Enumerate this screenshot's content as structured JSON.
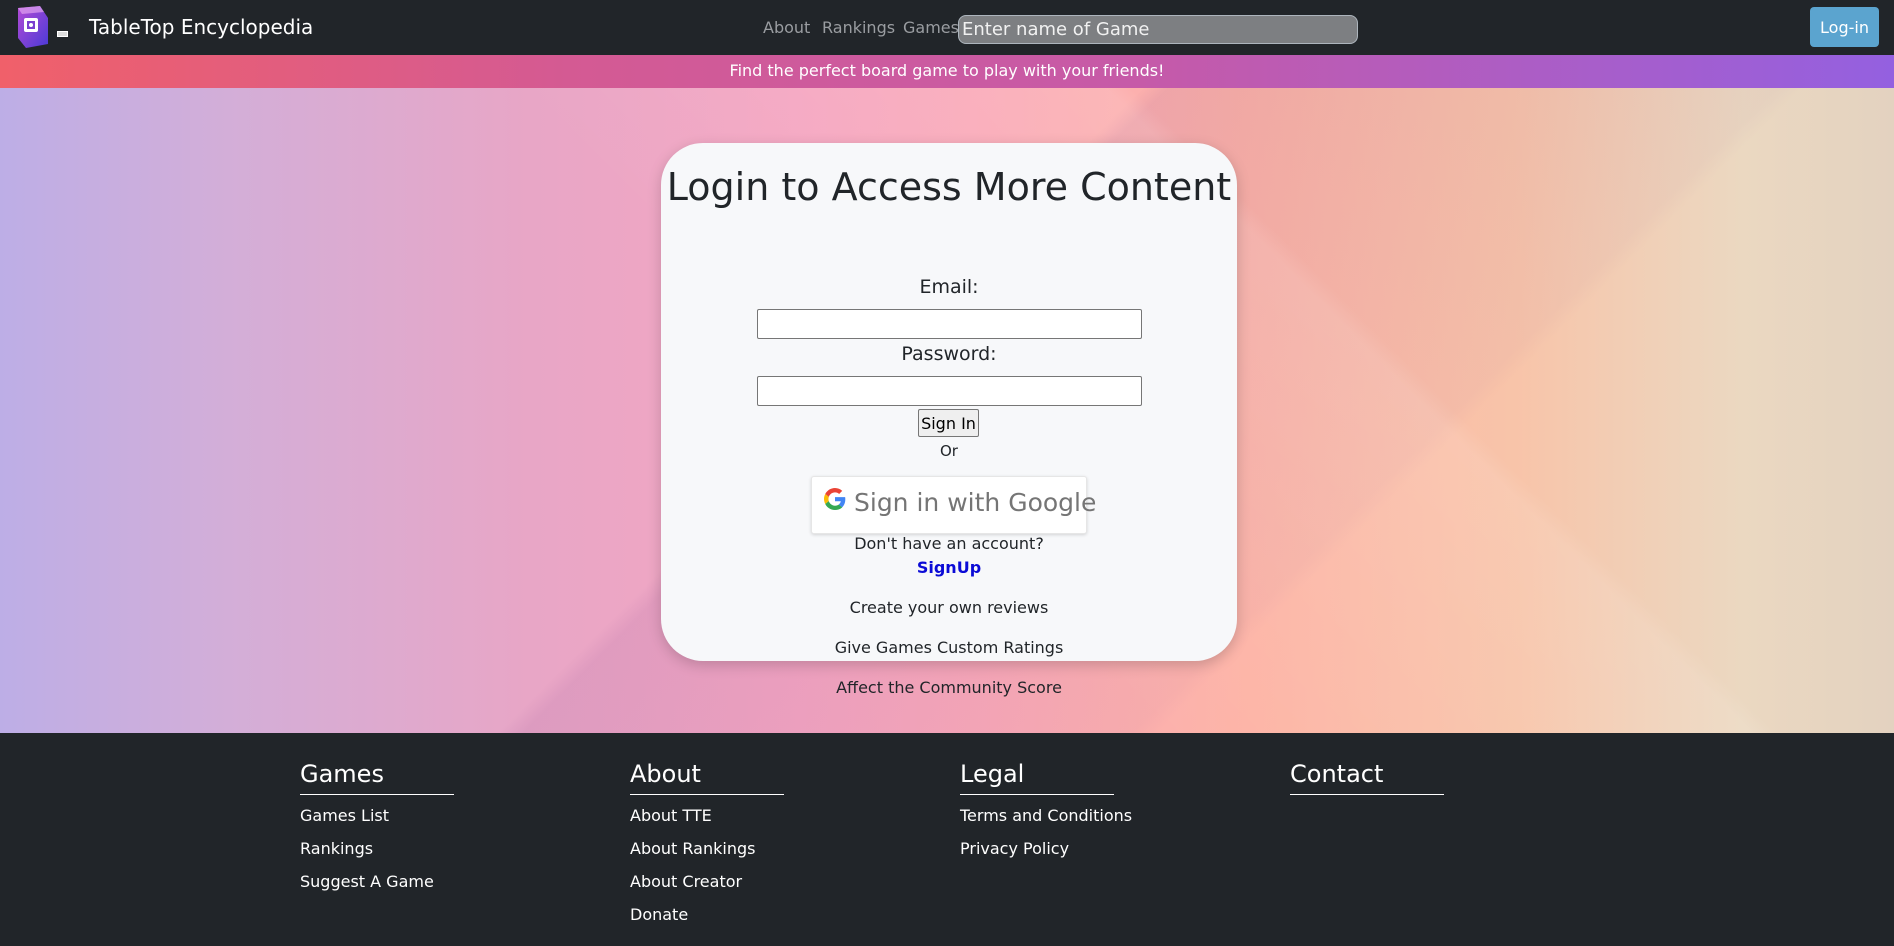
{
  "navbar": {
    "brand": "TableTop Encyclopedia",
    "links": [
      "About",
      "Rankings",
      "Games"
    ],
    "search_placeholder": "Enter name of Game",
    "login_label": "Log-in"
  },
  "banner": {
    "text": "Find the perfect board game to play with your friends!"
  },
  "login_card": {
    "title": "Login to Access More Content",
    "email_label": "Email:",
    "email_value": "",
    "password_label": "Password:",
    "password_value": "",
    "signin_label": "Sign In",
    "or_text": "Or",
    "google_label": "Sign in with Google",
    "no_account_text": "Don't have an account?",
    "signup_label": "SignUp",
    "benefits": [
      "Create your own reviews",
      "Give Games Custom Ratings",
      "Affect the Community Score"
    ]
  },
  "footer": {
    "columns": [
      {
        "heading": "Games",
        "links": [
          "Games List",
          "Rankings",
          "Suggest A Game"
        ]
      },
      {
        "heading": "About",
        "links": [
          "About TTE",
          "About Rankings",
          "About Creator",
          "Donate"
        ]
      },
      {
        "heading": "Legal",
        "links": [
          "Terms and Conditions",
          "Privacy Policy"
        ]
      },
      {
        "heading": "Contact",
        "links": []
      }
    ]
  },
  "icons": {
    "logo": "dice-logo-icon",
    "google": "google-g-icon"
  },
  "colors": {
    "navbar_bg": "#212529",
    "login_button": "#5ba4cf",
    "signup_link": "#0b0bd6"
  }
}
